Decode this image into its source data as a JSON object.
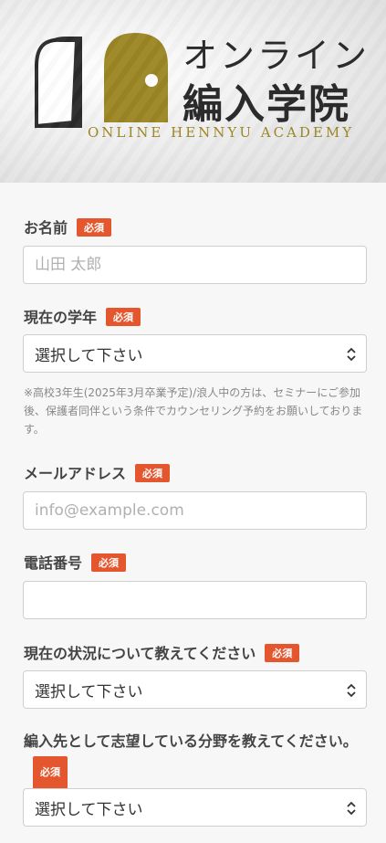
{
  "header": {
    "logo_title_line1": "オンライン",
    "logo_title_line2": "編入学院",
    "logo_subtitle": "ONLINE HENNYU ACADEMY"
  },
  "form": {
    "required_label": "必須",
    "name": {
      "label": "お名前",
      "placeholder": "山田 太郎"
    },
    "grade": {
      "label": "現在の学年",
      "selected": "選択して下さい"
    },
    "grade_note": "※高校3年生(2025年3月卒業予定)/浪人中の方は、セミナーにご参加後、保護者同伴という条件でカウンセリング予約をお願いしております。",
    "email": {
      "label": "メールアドレス",
      "placeholder": "info@example.com"
    },
    "phone": {
      "label": "電話番号",
      "placeholder": ""
    },
    "status": {
      "label": "現在の状況について教えてください",
      "selected": "選択して下さい"
    },
    "field": {
      "label": "編入先として志望している分野を教えてください。",
      "selected": "選択して下さい"
    }
  },
  "colors": {
    "badge": "#e4572e",
    "logo_gold": "#9c8625",
    "logo_dark": "#2b2b2b"
  }
}
